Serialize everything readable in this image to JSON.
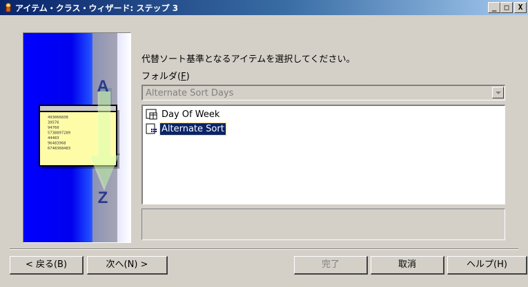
{
  "window": {
    "title": "アイテム・クラス・ウィザード: ステップ 3",
    "minimize_glyph": "_",
    "maximize_glyph": "□",
    "close_glyph": "X"
  },
  "illustration": {
    "letters": {
      "top": "A",
      "bottom": "Z"
    },
    "numbers": [
      "493066838",
      "39576",
      "94760",
      "5738897289",
      "44483",
      "96483968",
      "6748368483"
    ]
  },
  "content": {
    "instruction": "代替ソート基準となるアイテムを選択してください。",
    "folder_label": "フォルダ(",
    "folder_accel": "F",
    "folder_label_end": ")",
    "folder_value": "Alternate Sort Days"
  },
  "items": [
    {
      "label": "Day Of Week",
      "icon": "folder-icon",
      "selected": false
    },
    {
      "label": "Alternate Sort",
      "icon": "item-icon",
      "selected": true
    }
  ],
  "buttons": {
    "back": "< 戻る(B)",
    "next": "次へ(N) >",
    "finish": "完了",
    "cancel": "取消",
    "help": "ヘルプ(H)"
  },
  "colors": {
    "title_bar": "#0a246a",
    "selection": "#0a246a",
    "face": "#d4d0c8",
    "art_blue": "#0000ff"
  }
}
